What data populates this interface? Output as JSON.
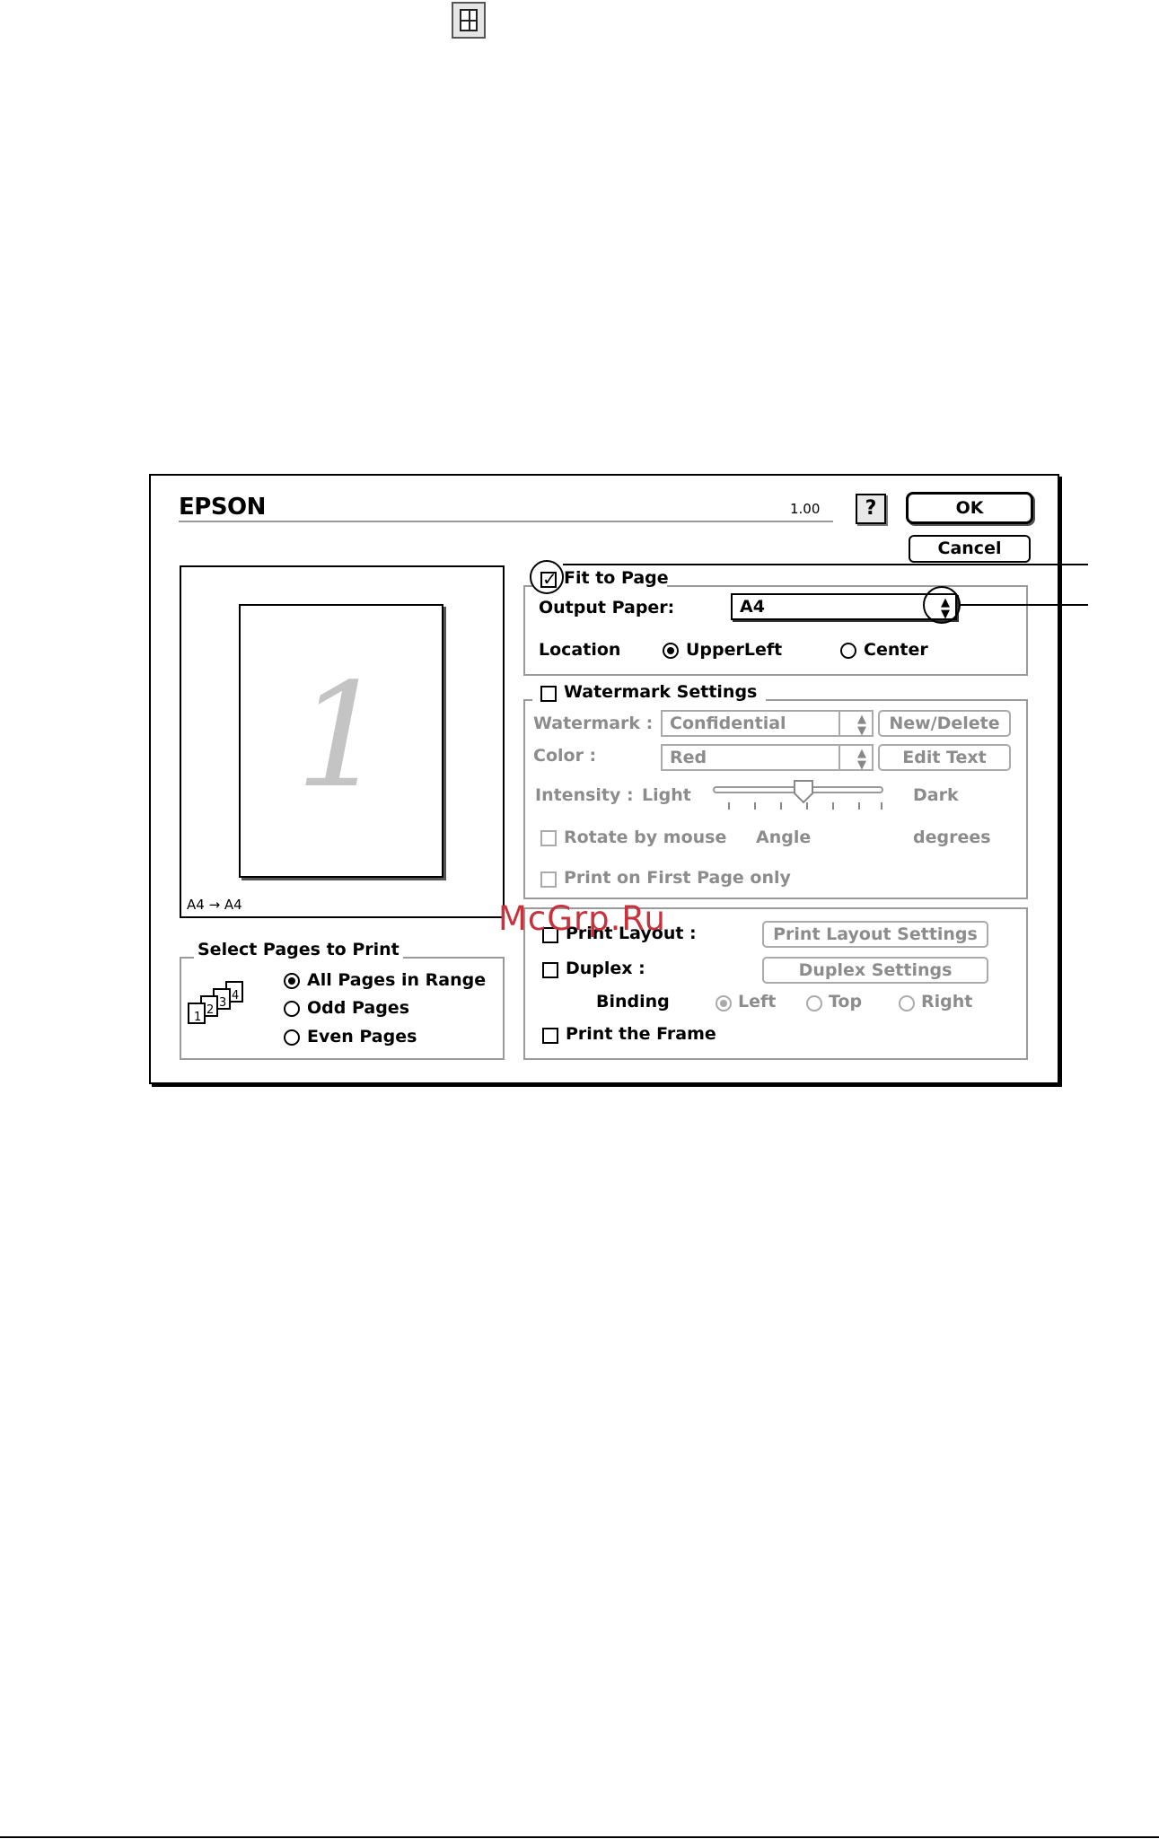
{
  "dialog": {
    "brand": "EPSON",
    "version": "1.00",
    "help_label": "?",
    "ok_label": "OK",
    "cancel_label": "Cancel"
  },
  "preview": {
    "page_number": "1",
    "paper_mapping": "A4 → A4"
  },
  "select_pages": {
    "title": "Select Pages to Print",
    "options": [
      "All Pages in Range",
      "Odd Pages",
      "Even Pages"
    ],
    "selected": "All Pages in Range",
    "stack_icons": [
      "1",
      "2",
      "3",
      "4"
    ]
  },
  "fit_to_page": {
    "label": "Fit to Page",
    "checked": true,
    "output_paper_label": "Output Paper:",
    "output_paper_value": "A4",
    "location_label": "Location",
    "location_options": [
      "UpperLeft",
      "Center"
    ],
    "location_selected": "UpperLeft"
  },
  "watermark": {
    "label": "Watermark Settings",
    "checked": false,
    "watermark_label": "Watermark :",
    "watermark_value": "Confidential",
    "new_delete_label": "New/Delete",
    "color_label": "Color :",
    "color_value": "Red",
    "edit_text_label": "Edit Text",
    "intensity_label": "Intensity :",
    "light_label": "Light",
    "dark_label": "Dark",
    "rotate_label": "Rotate by mouse",
    "angle_label": "Angle",
    "degrees_label": "degrees",
    "first_page_label": "Print on First Page only"
  },
  "layout": {
    "print_layout_label": "Print Layout :",
    "print_layout_settings_label": "Print Layout Settings",
    "duplex_label": "Duplex :",
    "duplex_settings_label": "Duplex Settings",
    "binding_label": "Binding",
    "binding_options": [
      "Left",
      "Top",
      "Right"
    ],
    "binding_selected": "Left",
    "print_frame_label": "Print the Frame"
  },
  "site_watermark": "McGrp.Ru",
  "colors": {
    "disabled_text": "#8c8c8c",
    "watermark_red": "#c8323c"
  }
}
